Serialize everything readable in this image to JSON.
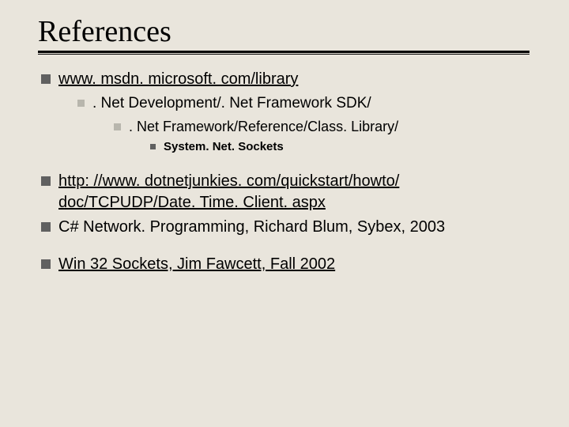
{
  "title": "References",
  "items": {
    "ref1": {
      "link": "www. msdn. microsoft. com/library",
      "sub1": ". Net Development/. Net Framework SDK/",
      "sub2": ". Net Framework/Reference/Class. Library/",
      "sub3": "System. Net. Sockets"
    },
    "ref2": {
      "line1": "http: //www. dotnetjunkies. com/quickstart/howto/",
      "line2": "doc/TCPUDP/Date. Time. Client. aspx"
    },
    "ref3": "C# Network. Programming, Richard Blum, Sybex, 2003",
    "ref4": "Win 32 Sockets, Jim Fawcett, Fall 2002"
  }
}
